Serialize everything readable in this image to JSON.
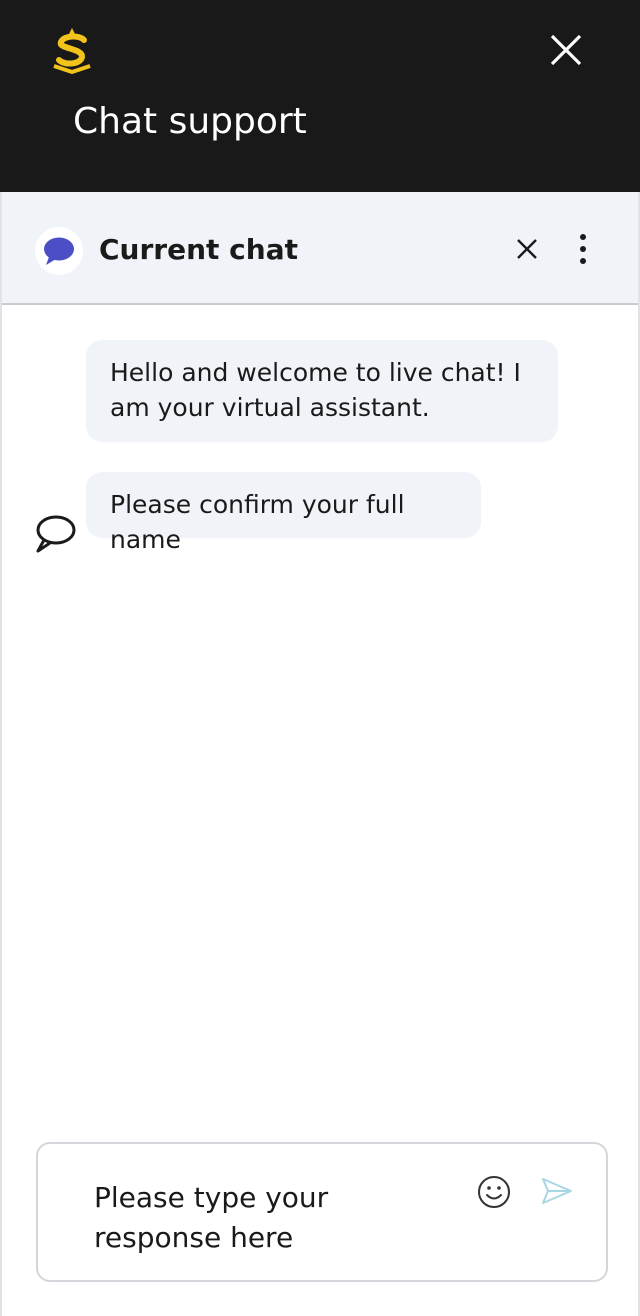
{
  "header": {
    "title": "Chat support",
    "logo_icon": "brand-s-logo-icon",
    "close_icon": "close-icon",
    "logo_color": "#f2c31b",
    "background": "#191919"
  },
  "chat": {
    "title": "Current chat",
    "avatar_icon": "speech-bubble-icon",
    "avatar_color": "#4b4ec4",
    "close_icon": "close-icon",
    "menu_icon": "more-vertical-icon",
    "messages": [
      {
        "sender": "bot",
        "text": "Hello and welcome to live chat! I am your virtual assistant."
      },
      {
        "sender": "bot",
        "text": "Please confirm your full name"
      }
    ],
    "bot_icon": "chat-bubble-outline-icon"
  },
  "composer": {
    "placeholder": "Please type your response here",
    "value": "",
    "emoji_icon": "smiley-icon",
    "send_icon": "send-icon",
    "send_color": "#a9d6e5"
  }
}
